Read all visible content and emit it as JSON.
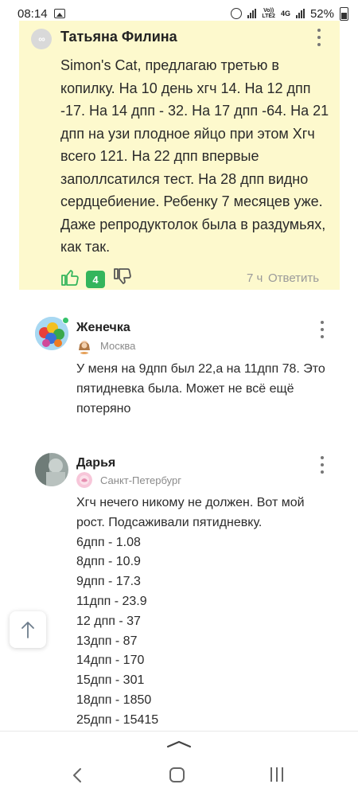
{
  "status_bar": {
    "time": "08:14",
    "network_top": "Vo))",
    "network_bottom": "LTE2",
    "network2": "4G",
    "battery": "52%"
  },
  "highlighted_comment": {
    "author": "Татьяна Филина",
    "text": "Simon's Cat, предлагаю третью в копилку. На 10 день хгч 14. На 12 дпп -17. На 14 дпп - 32. На 17 дпп -64. На 21 дпп на узи плодное яйцо при этом Хгч всего 121. На 22 дпп впервые заполлсатился тест. На 28 дпп видно сердцебиение. Ребенку 7 месяцев уже. Даже репродуктолок была в раздумьях, как так.",
    "likes": "4",
    "time": "7 ч",
    "reply_label": "Ответить",
    "accent_color": "#34b55c",
    "background_color": "#fdf9cd"
  },
  "comments": [
    {
      "author": "Женечка",
      "city": "Москва",
      "text": "У меня на 9дпп был 22,а на 11дпп 78. Это пятидневка была. Может не всё ещё потеряно"
    },
    {
      "author": "Дарья",
      "city": "Санкт-Петербург",
      "text_lines": [
        "Хгч нечего никому не должен. Вот мой",
        "рост. Подсаживали пятидневку.",
        "6дпп - 1.08",
        "8дпп - 10.9",
        "9дпп - 17.3",
        "11дпп - 23.9",
        "12 дпп - 37",
        "13дпп - 87",
        "14дпп - 170",
        "15дпп - 301",
        "18дпп - 1850",
        "25дпп - 15415"
      ]
    }
  ]
}
